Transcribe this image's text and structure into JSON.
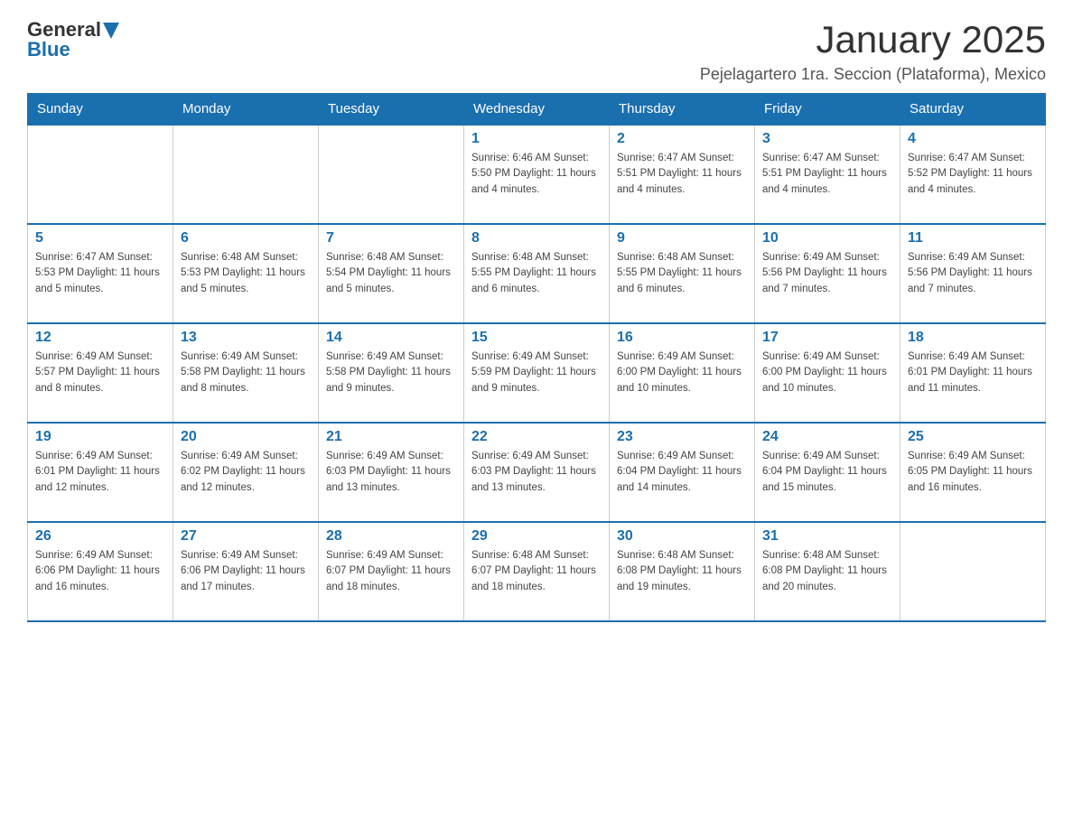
{
  "header": {
    "logo_general": "General",
    "logo_blue": "Blue",
    "title": "January 2025",
    "subtitle": "Pejelagartero 1ra. Seccion (Plataforma), Mexico"
  },
  "columns": [
    "Sunday",
    "Monday",
    "Tuesday",
    "Wednesday",
    "Thursday",
    "Friday",
    "Saturday"
  ],
  "weeks": [
    [
      {
        "day": "",
        "info": ""
      },
      {
        "day": "",
        "info": ""
      },
      {
        "day": "",
        "info": ""
      },
      {
        "day": "1",
        "info": "Sunrise: 6:46 AM\nSunset: 5:50 PM\nDaylight: 11 hours and 4 minutes."
      },
      {
        "day": "2",
        "info": "Sunrise: 6:47 AM\nSunset: 5:51 PM\nDaylight: 11 hours and 4 minutes."
      },
      {
        "day": "3",
        "info": "Sunrise: 6:47 AM\nSunset: 5:51 PM\nDaylight: 11 hours and 4 minutes."
      },
      {
        "day": "4",
        "info": "Sunrise: 6:47 AM\nSunset: 5:52 PM\nDaylight: 11 hours and 4 minutes."
      }
    ],
    [
      {
        "day": "5",
        "info": "Sunrise: 6:47 AM\nSunset: 5:53 PM\nDaylight: 11 hours and 5 minutes."
      },
      {
        "day": "6",
        "info": "Sunrise: 6:48 AM\nSunset: 5:53 PM\nDaylight: 11 hours and 5 minutes."
      },
      {
        "day": "7",
        "info": "Sunrise: 6:48 AM\nSunset: 5:54 PM\nDaylight: 11 hours and 5 minutes."
      },
      {
        "day": "8",
        "info": "Sunrise: 6:48 AM\nSunset: 5:55 PM\nDaylight: 11 hours and 6 minutes."
      },
      {
        "day": "9",
        "info": "Sunrise: 6:48 AM\nSunset: 5:55 PM\nDaylight: 11 hours and 6 minutes."
      },
      {
        "day": "10",
        "info": "Sunrise: 6:49 AM\nSunset: 5:56 PM\nDaylight: 11 hours and 7 minutes."
      },
      {
        "day": "11",
        "info": "Sunrise: 6:49 AM\nSunset: 5:56 PM\nDaylight: 11 hours and 7 minutes."
      }
    ],
    [
      {
        "day": "12",
        "info": "Sunrise: 6:49 AM\nSunset: 5:57 PM\nDaylight: 11 hours and 8 minutes."
      },
      {
        "day": "13",
        "info": "Sunrise: 6:49 AM\nSunset: 5:58 PM\nDaylight: 11 hours and 8 minutes."
      },
      {
        "day": "14",
        "info": "Sunrise: 6:49 AM\nSunset: 5:58 PM\nDaylight: 11 hours and 9 minutes."
      },
      {
        "day": "15",
        "info": "Sunrise: 6:49 AM\nSunset: 5:59 PM\nDaylight: 11 hours and 9 minutes."
      },
      {
        "day": "16",
        "info": "Sunrise: 6:49 AM\nSunset: 6:00 PM\nDaylight: 11 hours and 10 minutes."
      },
      {
        "day": "17",
        "info": "Sunrise: 6:49 AM\nSunset: 6:00 PM\nDaylight: 11 hours and 10 minutes."
      },
      {
        "day": "18",
        "info": "Sunrise: 6:49 AM\nSunset: 6:01 PM\nDaylight: 11 hours and 11 minutes."
      }
    ],
    [
      {
        "day": "19",
        "info": "Sunrise: 6:49 AM\nSunset: 6:01 PM\nDaylight: 11 hours and 12 minutes."
      },
      {
        "day": "20",
        "info": "Sunrise: 6:49 AM\nSunset: 6:02 PM\nDaylight: 11 hours and 12 minutes."
      },
      {
        "day": "21",
        "info": "Sunrise: 6:49 AM\nSunset: 6:03 PM\nDaylight: 11 hours and 13 minutes."
      },
      {
        "day": "22",
        "info": "Sunrise: 6:49 AM\nSunset: 6:03 PM\nDaylight: 11 hours and 13 minutes."
      },
      {
        "day": "23",
        "info": "Sunrise: 6:49 AM\nSunset: 6:04 PM\nDaylight: 11 hours and 14 minutes."
      },
      {
        "day": "24",
        "info": "Sunrise: 6:49 AM\nSunset: 6:04 PM\nDaylight: 11 hours and 15 minutes."
      },
      {
        "day": "25",
        "info": "Sunrise: 6:49 AM\nSunset: 6:05 PM\nDaylight: 11 hours and 16 minutes."
      }
    ],
    [
      {
        "day": "26",
        "info": "Sunrise: 6:49 AM\nSunset: 6:06 PM\nDaylight: 11 hours and 16 minutes."
      },
      {
        "day": "27",
        "info": "Sunrise: 6:49 AM\nSunset: 6:06 PM\nDaylight: 11 hours and 17 minutes."
      },
      {
        "day": "28",
        "info": "Sunrise: 6:49 AM\nSunset: 6:07 PM\nDaylight: 11 hours and 18 minutes."
      },
      {
        "day": "29",
        "info": "Sunrise: 6:48 AM\nSunset: 6:07 PM\nDaylight: 11 hours and 18 minutes."
      },
      {
        "day": "30",
        "info": "Sunrise: 6:48 AM\nSunset: 6:08 PM\nDaylight: 11 hours and 19 minutes."
      },
      {
        "day": "31",
        "info": "Sunrise: 6:48 AM\nSunset: 6:08 PM\nDaylight: 11 hours and 20 minutes."
      },
      {
        "day": "",
        "info": ""
      }
    ]
  ]
}
